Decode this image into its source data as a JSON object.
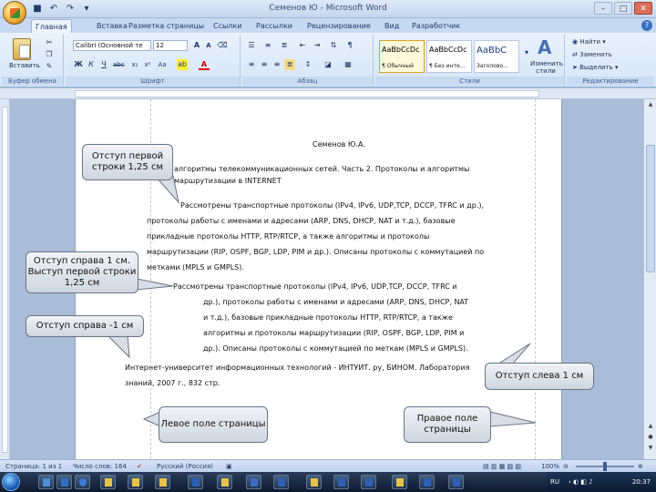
{
  "window": {
    "title": "Семенов Ю - Microsoft Word"
  },
  "tabs": [
    "Главная",
    "Вставка",
    "Разметка страницы",
    "Ссылки",
    "Рассылки",
    "Рецензирование",
    "Вид",
    "Разработчик"
  ],
  "ribbon": {
    "clipboard": {
      "paste_label": "Вставить",
      "group_label": "Буфер обмена"
    },
    "font": {
      "name": "Calibri (Основной те",
      "size": "12",
      "group_label": "Шрифт"
    },
    "paragraph": {
      "group_label": "Абзац"
    },
    "styles": {
      "tiles": [
        {
          "sample": "AaBbCcDc",
          "name": "¶ Обычный"
        },
        {
          "sample": "AaBbCcDc",
          "name": "¶ Без инте..."
        },
        {
          "sample": "AaBbC",
          "name": "Заголово..."
        }
      ],
      "change_label": "Изменить стили",
      "group_label": "Стили"
    },
    "editing": {
      "find": "Найти",
      "replace": "Заменить",
      "select": "Выделить",
      "group_label": "Редактирование"
    }
  },
  "document": {
    "author": "Семенов Ю.А.",
    "para1_line1": "алгоритмы телекоммуникационных сетей. Часть 2. Протоколы и алгоритмы",
    "para1_line2": "маршрутизации в INTERNET",
    "para2": [
      "Рассмотрены транспортные протоколы (IPv4, IPv6, UDP,TCP, DCCP, TFRC и др.),",
      "протоколы работы с именами и адресами (ARP, DNS, DHCP, NAT и т.д.), базовые",
      "прикладные протоколы HTTP, RTP/RTCP, а также алгоритмы и протоколы",
      "маршрутизации (RIP, OSPF, BGP, LDP, PIM и др.). Описаны протоколы с коммутацией по",
      "метками (MPLS и GMPLS)."
    ],
    "para3": [
      "Рассмотрены транспортные протоколы (IPv4, IPv6, UDP,TCP, DCCP, TFRC и",
      "др.), протоколы работы с именами и адресами (ARP, DNS, DHCP, NAT",
      "и т.д.), базовые прикладные протоколы HTTP, RTP/RTCP, а также",
      "алгоритмы и протоколы маршрутизации (RIP, OSPF, BGP, LDP, PIM и",
      "др.). Описаны протоколы с коммутацией по меткам (MPLS и GMPLS)."
    ],
    "para4_line1": "Интернет-университет информационных технологий - ИНТУИТ. ру, БИНОМ. Лаборатория",
    "para4_line2": "знаний, 2007 г., 832 стр."
  },
  "callouts": {
    "first_indent": "Отступ первой строки 1,25 см",
    "right_indent_hang": "Отступ справа 1 см. Выступ первой строки 1,25 см",
    "right_minus": "Отступ справа  -1 см",
    "left_indent": "Отступ слева 1 см",
    "left_margin": "Левое поле страницы",
    "right_margin": "Правое поле страницы"
  },
  "status": {
    "page": "Страница: 1 из 1",
    "words": "Число слов: 164",
    "language": "Русский (Россия)",
    "zoom": "100%"
  },
  "taskbar": {
    "lang": "RU",
    "time": "20:37"
  }
}
